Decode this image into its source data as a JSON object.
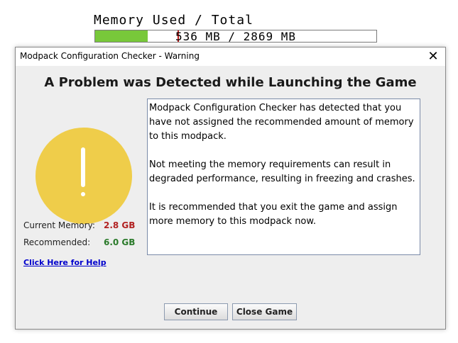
{
  "memory": {
    "title": "Memory Used / Total",
    "usage_text": "536 MB / 2869 MB",
    "used_fraction": 0.187,
    "fill_color": "#78c83a"
  },
  "dialog": {
    "title": "Modpack Configuration Checker - Warning",
    "close_icon": "close-icon",
    "heading": "A Problem was Detected while Launching the Game",
    "warning_icon": "warning-exclamation-icon",
    "warning_color": "#efcd4a",
    "message": [
      "Modpack Configuration Checker has detected that you have not assigned the recommended amount of memory to this modpack.",
      "Not meeting the memory requirements can result in degraded performance, resulting in freezing and crashes.",
      "It is recommended that you exit the game and assign more memory to this modpack now."
    ],
    "current_memory_label": "Current Memory:",
    "current_memory_value": "2.8 GB",
    "current_memory_color": "#b22222",
    "recommended_label": "Recommended:",
    "recommended_value": "6.0 GB",
    "recommended_color": "#2a7a2a",
    "help_link": "Click Here for Help",
    "continue_label": "Continue",
    "close_game_label": "Close Game"
  }
}
